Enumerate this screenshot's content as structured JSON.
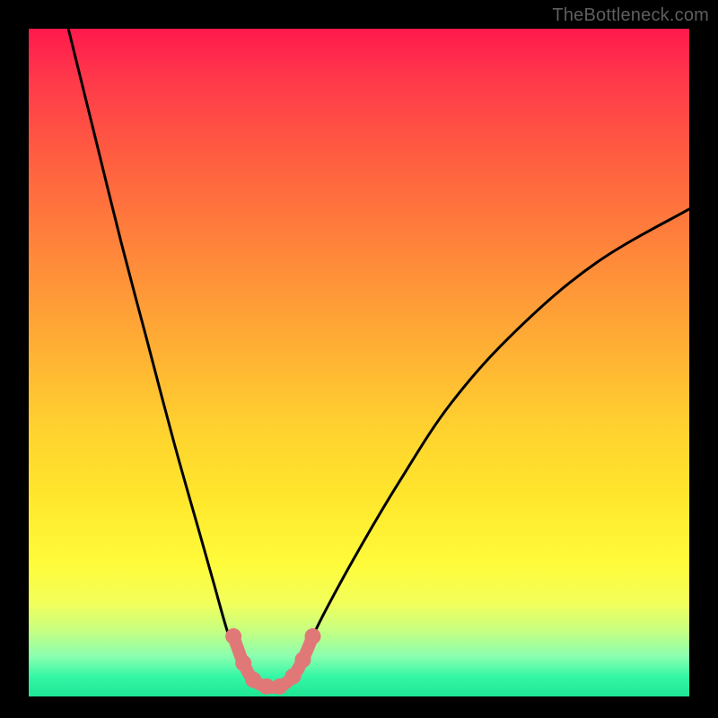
{
  "watermark": "TheBottleneck.com",
  "chart_data": {
    "type": "line",
    "title": "",
    "xlabel": "",
    "ylabel": "",
    "xlim": [
      0,
      100
    ],
    "ylim": [
      0,
      100
    ],
    "series": [
      {
        "name": "black-curve-left",
        "color": "#000000",
        "x": [
          6,
          10,
          14,
          18,
          22,
          26,
          28,
          30,
          31.5,
          33
        ],
        "y": [
          100,
          84,
          68,
          53,
          38,
          24,
          17,
          10,
          6,
          3
        ]
      },
      {
        "name": "black-curve-right",
        "color": "#000000",
        "x": [
          40,
          42,
          45,
          50,
          56,
          64,
          74,
          86,
          100
        ],
        "y": [
          3,
          7,
          13,
          22,
          32,
          44,
          55,
          65,
          73
        ]
      },
      {
        "name": "pink-curve",
        "color": "#e07878",
        "x": [
          31,
          32.5,
          34,
          36,
          38,
          40,
          41.5,
          43
        ],
        "y": [
          9,
          5,
          2.5,
          1.5,
          1.5,
          3,
          5.5,
          9
        ]
      }
    ],
    "legend": null,
    "grid": false
  }
}
